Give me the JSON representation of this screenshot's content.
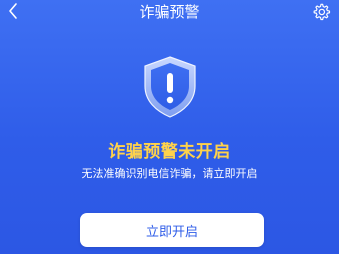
{
  "header": {
    "title": "诈骗预警",
    "back_icon": "chevron-left-icon",
    "settings_icon": "gear-icon"
  },
  "status": {
    "icon": "shield-alert-icon",
    "title": "诈骗预警未开启",
    "description": "无法准确识别电信诈骗，请立即开启"
  },
  "action": {
    "label": "立即开启"
  },
  "colors": {
    "background": "#3366EE",
    "accent_yellow": "#FFD24A",
    "button_text": "#2F5DE8",
    "button_bg": "#FFFFFF"
  }
}
